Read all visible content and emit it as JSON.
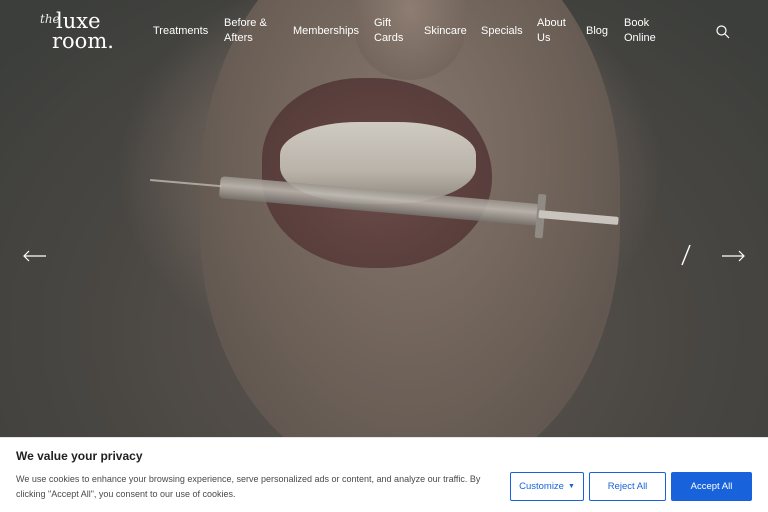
{
  "logo": {
    "script": "the",
    "line1": "luxe",
    "line2": "room",
    "dot": "."
  },
  "nav": {
    "treatments": "Treatments",
    "before_afters": [
      "Before &",
      "Afters"
    ],
    "memberships": "Memberships",
    "gift_cards": [
      "Gift",
      "Cards"
    ],
    "skincare": "Skincare",
    "specials": "Specials",
    "about_us": [
      "About",
      "Us"
    ],
    "blog": "Blog",
    "book_online": [
      "Book",
      "Online"
    ]
  },
  "icons": {
    "search": "search-icon",
    "arrow_left": "arrow-left-icon",
    "arrow_right": "arrow-right-icon"
  },
  "cookie": {
    "title": "We value your privacy",
    "text": "We use cookies to enhance your browsing experience, serve personalized ads or content, and analyze our traffic. By clicking \"Accept All\", you consent to our use of cookies.",
    "customize_label": "Customize",
    "reject_label": "Reject All",
    "accept_label": "Accept All"
  },
  "colors": {
    "accent": "#1863dc",
    "nav_text": "#ffffff",
    "banner_bg": "#ffffff"
  }
}
